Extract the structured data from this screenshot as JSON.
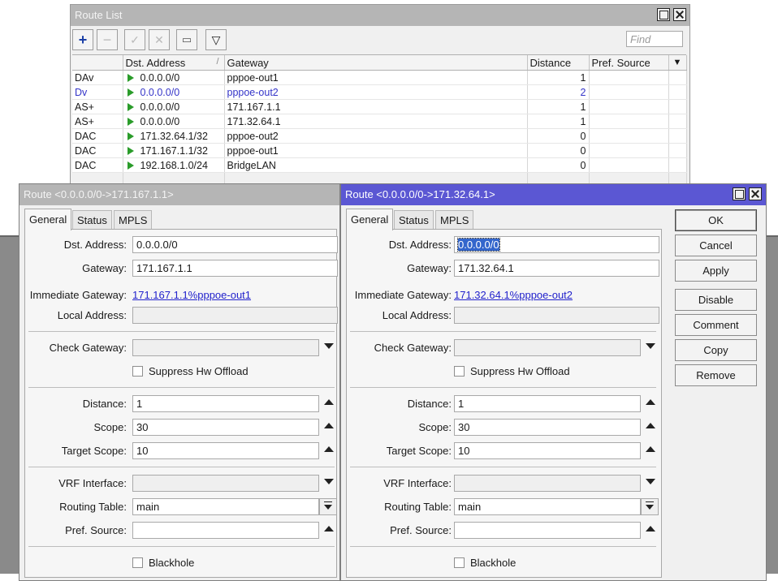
{
  "route_list": {
    "title": "Route List",
    "find_placeholder": "Find",
    "columns": [
      "",
      "Dst. Address",
      "Gateway",
      "Distance",
      "Pref. Source"
    ],
    "sort_indicator": "/",
    "rows": [
      {
        "flags": "DAv",
        "dst": "0.0.0.0/0",
        "gateway": "pppoe-out1",
        "distance": "1",
        "pref_source": ""
      },
      {
        "flags": "Dv",
        "dst": "0.0.0.0/0",
        "gateway": "pppoe-out2",
        "distance": "2",
        "pref_source": ""
      },
      {
        "flags": "AS+",
        "dst": "0.0.0.0/0",
        "gateway": "171.167.1.1",
        "distance": "1",
        "pref_source": ""
      },
      {
        "flags": "AS+",
        "dst": "0.0.0.0/0",
        "gateway": "171.32.64.1",
        "distance": "1",
        "pref_source": ""
      },
      {
        "flags": "DAC",
        "dst": "171.32.64.1/32",
        "gateway": "pppoe-out2",
        "distance": "0",
        "pref_source": ""
      },
      {
        "flags": "DAC",
        "dst": "171.167.1.1/32",
        "gateway": "pppoe-out1",
        "distance": "0",
        "pref_source": ""
      },
      {
        "flags": "DAC",
        "dst": "192.168.1.0/24",
        "gateway": "BridgeLAN",
        "distance": "0",
        "pref_source": ""
      }
    ]
  },
  "labels": {
    "dst_address": "Dst. Address:",
    "gateway": "Gateway:",
    "immediate_gateway": "Immediate Gateway:",
    "local_address": "Local Address:",
    "check_gateway": "Check Gateway:",
    "suppress_hw_offload": "Suppress Hw Offload",
    "distance": "Distance:",
    "scope": "Scope:",
    "target_scope": "Target Scope:",
    "vrf_interface": "VRF Interface:",
    "routing_table": "Routing Table:",
    "pref_source": "Pref. Source:",
    "blackhole": "Blackhole"
  },
  "tabs": [
    "General",
    "Status",
    "MPLS"
  ],
  "dialog_left": {
    "title": "Route <0.0.0.0/0->171.167.1.1>",
    "dst_address": "0.0.0.0/0",
    "gateway": "171.167.1.1",
    "immediate_gateway": "171.167.1.1%pppoe-out1",
    "local_address": "",
    "check_gateway": "",
    "distance": "1",
    "scope": "30",
    "target_scope": "10",
    "vrf_interface": "",
    "routing_table": "main",
    "pref_source": ""
  },
  "dialog_right": {
    "title": "Route <0.0.0.0/0->171.32.64.1>",
    "dst_address": "0.0.0.0/0",
    "gateway": "171.32.64.1",
    "immediate_gateway": "171.32.64.1%pppoe-out2",
    "local_address": "",
    "check_gateway": "",
    "distance": "1",
    "scope": "30",
    "target_scope": "10",
    "vrf_interface": "",
    "routing_table": "main",
    "pref_source": ""
  },
  "buttons": {
    "ok": "OK",
    "cancel": "Cancel",
    "apply": "Apply",
    "disable": "Disable",
    "comment": "Comment",
    "copy": "Copy",
    "remove": "Remove"
  },
  "colors": {
    "active_title": "#5b57d3",
    "inactive_title": "#b5b5b5",
    "link": "#2222cc",
    "flag_green": "#2a9c2a",
    "inactive_row": "#3434c8"
  }
}
